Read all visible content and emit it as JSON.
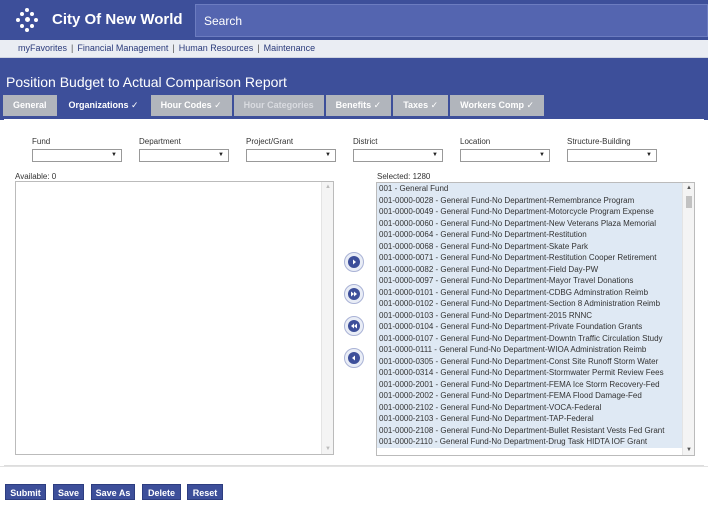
{
  "app": {
    "title": "City Of New World",
    "logo_icon": "flower-logo-icon",
    "brand_color": "#3d4f9a"
  },
  "search": {
    "placeholder": "Search"
  },
  "nav": {
    "links": [
      "myFavorites",
      "Financial Management",
      "Human Resources",
      "Maintenance"
    ],
    "separator": "|"
  },
  "page": {
    "title": "Position Budget to Actual Comparison Report"
  },
  "tabs": [
    {
      "label": "General",
      "state": "normal"
    },
    {
      "label": "Organizations ✓",
      "state": "active"
    },
    {
      "label": "Hour Codes ✓",
      "state": "normal"
    },
    {
      "label": "Hour Categories",
      "state": "disabled"
    },
    {
      "label": "Benefits ✓",
      "state": "normal"
    },
    {
      "label": "Taxes ✓",
      "state": "normal"
    },
    {
      "label": "Workers Comp ✓",
      "state": "normal"
    }
  ],
  "filters": [
    {
      "label": "Fund",
      "value": ""
    },
    {
      "label": "Department",
      "value": ""
    },
    {
      "label": "Project/Grant",
      "value": ""
    },
    {
      "label": "District",
      "value": ""
    },
    {
      "label": "Location",
      "value": ""
    },
    {
      "label": "Structure-Building",
      "value": ""
    }
  ],
  "available": {
    "label": "Available: 0",
    "items": []
  },
  "selected": {
    "label": "Selected: 1280",
    "items": [
      "001 - General Fund",
      "001-0000-0028 - General Fund-No Department-Remembrance Program",
      "001-0000-0049 - General Fund-No Department-Motorcycle Program Expense",
      "001-0000-0060 - General Fund-No Department-New Veterans Plaza Memorial",
      "001-0000-0064 - General Fund-No Department-Restitution",
      "001-0000-0068 - General Fund-No Department-Skate Park",
      "001-0000-0071 - General Fund-No Department-Restitution Cooper Retirement",
      "001-0000-0082 - General Fund-No Department-Field Day-PW",
      "001-0000-0097 - General Fund-No Department-Mayor Travel Donations",
      "001-0000-0101 - General Fund-No Department-CDBG Adminstration Reimb",
      "001-0000-0102 - General Fund-No Department-Section 8 Administration Reimb",
      "001-0000-0103 - General Fund-No Department-2015 RNNC",
      "001-0000-0104 - General Fund-No Department-Private Foundation Grants",
      "001-0000-0107 - General Fund-No Department-Downtn Traffic Circulation Study",
      "001-0000-0111 - General Fund-No Department-WIOA Administration Reimb",
      "001-0000-0305 - General Fund-No Department-Const Site Runoff Storm Water",
      "001-0000-0314 - General Fund-No Department-Stormwater Permit Review Fees",
      "001-0000-2001 - General Fund-No Department-FEMA Ice Storm Recovery-Fed",
      "001-0000-2002 - General Fund-No Department-FEMA Flood Damage-Fed",
      "001-0000-2102 - General Fund-No Department-VOCA-Federal",
      "001-0000-2103 - General Fund-No Department-TAP-Federal",
      "001-0000-2108 - General Fund-No Department-Bullet Resistant Vests Fed Grant",
      "001-0000-2110 - General Fund-No Department-Drug Task HIDTA IOF Grant"
    ]
  },
  "move_buttons": [
    {
      "name": "move-right-button",
      "icon": "arrow-right-icon"
    },
    {
      "name": "move-all-right-button",
      "icon": "double-arrow-right-icon"
    },
    {
      "name": "move-all-left-button",
      "icon": "double-arrow-left-icon"
    },
    {
      "name": "move-left-button",
      "icon": "arrow-left-icon"
    }
  ],
  "actions": {
    "submit": "Submit",
    "save": "Save",
    "save_as": "Save As",
    "delete": "Delete",
    "reset": "Reset"
  }
}
